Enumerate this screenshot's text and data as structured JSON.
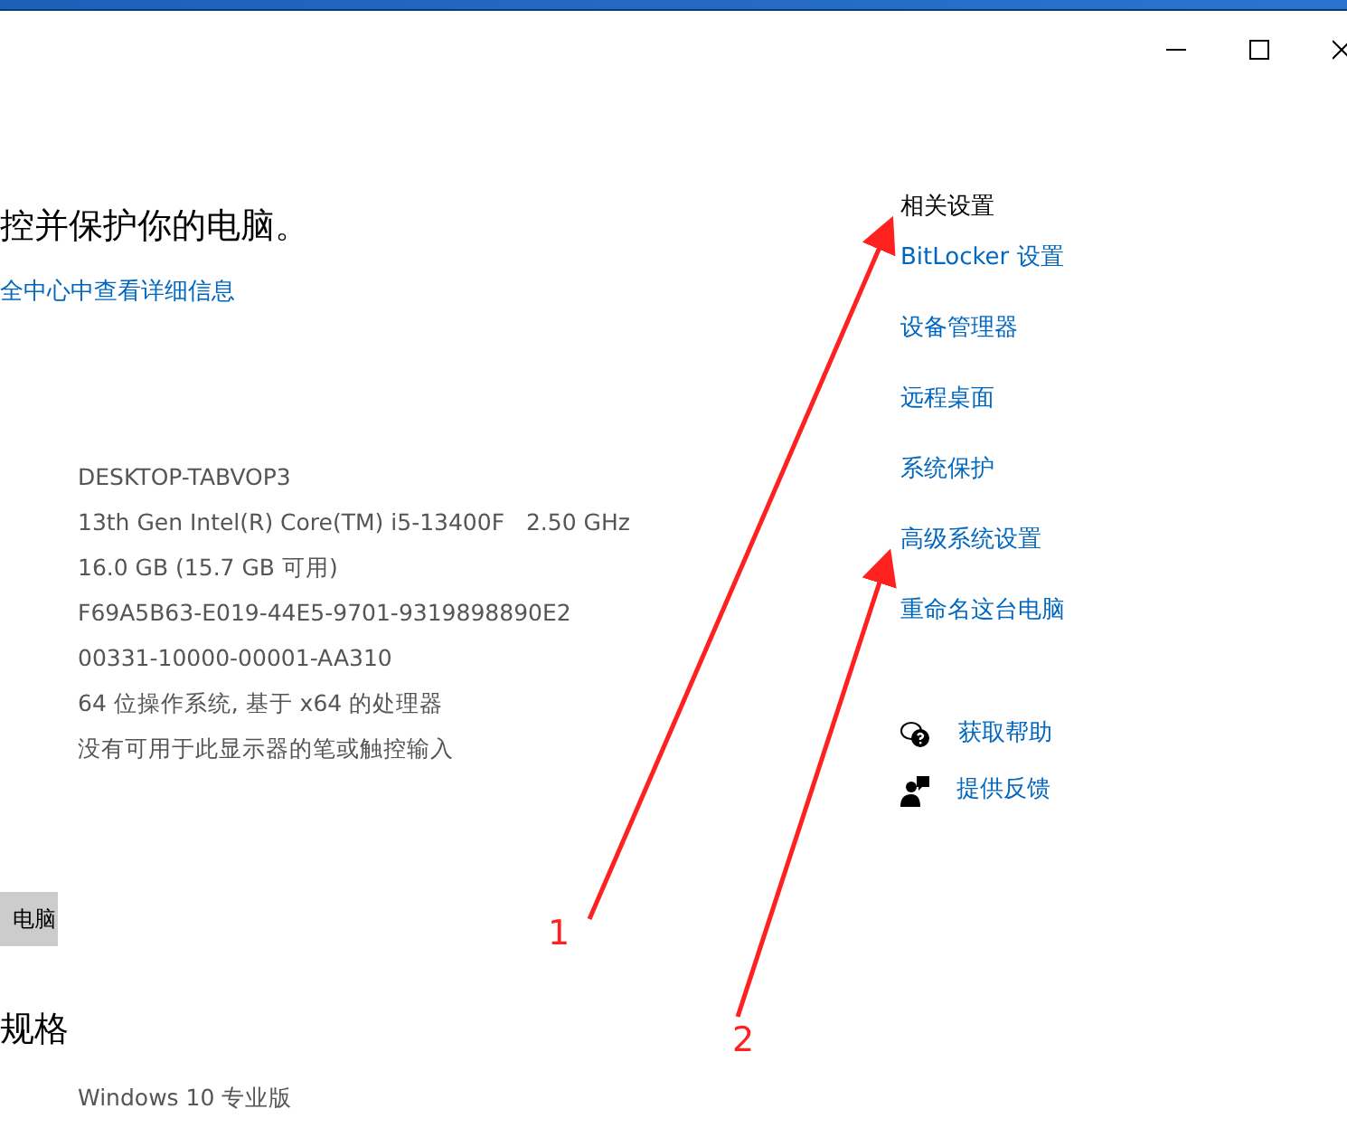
{
  "window": {
    "controls": [
      {
        "kind": "minimize"
      },
      {
        "kind": "maximize"
      },
      {
        "kind": "close"
      }
    ]
  },
  "main": {
    "heading": "控并保护你的电脑。",
    "link": "全中心中查看详细信息",
    "specs": [
      "DESKTOP-TABVOP3",
      "13th Gen Intel(R) Core(TM) i5-13400F   2.50 GHz",
      "16.0 GB (15.7 GB 可用)",
      "F69A5B63-E019-44E5-9701-9319898890E2",
      "00331-10000-00001-AA310",
      "64 位操作系统, 基于 x64 的处理器",
      "没有可用于此显示器的笔或触控输入"
    ],
    "button": "电脑",
    "section_heading": "规格",
    "windows_specs": [
      "Windows 10 专业版"
    ]
  },
  "related": {
    "title": "相关设置",
    "links": [
      "BitLocker 设置",
      "设备管理器",
      "远程桌面",
      "系统保护",
      "高级系统设置",
      "重命名这台电脑"
    ],
    "help": [
      {
        "kind": "help",
        "label": "获取帮助"
      },
      {
        "kind": "feedback",
        "label": "提供反馈"
      }
    ]
  },
  "annotations": [
    {
      "label": "1"
    },
    {
      "label": "2"
    }
  ]
}
